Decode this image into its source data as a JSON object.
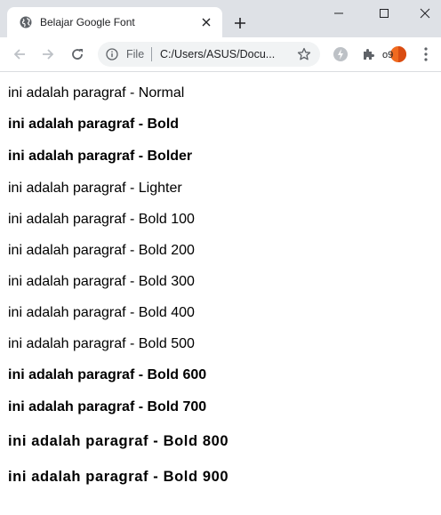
{
  "tab": {
    "title": "Belajar Google Font",
    "favicon": "globe-icon"
  },
  "window_controls": [
    "minimize-icon",
    "maximize-icon",
    "close-icon"
  ],
  "toolbar": {
    "scheme_label": "File",
    "url": "C:/Users/ASUS/Docu...",
    "avatar_text": "o9"
  },
  "paragraphs": [
    {
      "text": "ini adalah paragraf - Normal",
      "weight": "normal"
    },
    {
      "text": "ini adalah paragraf - Bold",
      "weight": "bold"
    },
    {
      "text": "ini adalah paragraf - Bolder",
      "weight": "bolder"
    },
    {
      "text": "ini adalah paragraf - Lighter",
      "weight": "lighter"
    },
    {
      "text": "ini adalah paragraf - Bold 100",
      "weight": "100"
    },
    {
      "text": "ini adalah paragraf - Bold 200",
      "weight": "200"
    },
    {
      "text": "ini adalah paragraf - Bold 300",
      "weight": "300"
    },
    {
      "text": "ini adalah paragraf - Bold 400",
      "weight": "400"
    },
    {
      "text": "ini adalah paragraf - Bold 500",
      "weight": "500"
    },
    {
      "text": "ini adalah paragraf - Bold 600",
      "weight": "600"
    },
    {
      "text": "ini adalah paragraf - Bold 700",
      "weight": "700"
    },
    {
      "text": "ini adalah paragraf - Bold 800",
      "weight": "800"
    },
    {
      "text": "ini adalah paragraf - Bold 900",
      "weight": "900"
    }
  ],
  "colors": {
    "titlebar": "#dee1e6",
    "omnibox": "#f1f3f4",
    "avatar_accent": "#f06a1f"
  }
}
